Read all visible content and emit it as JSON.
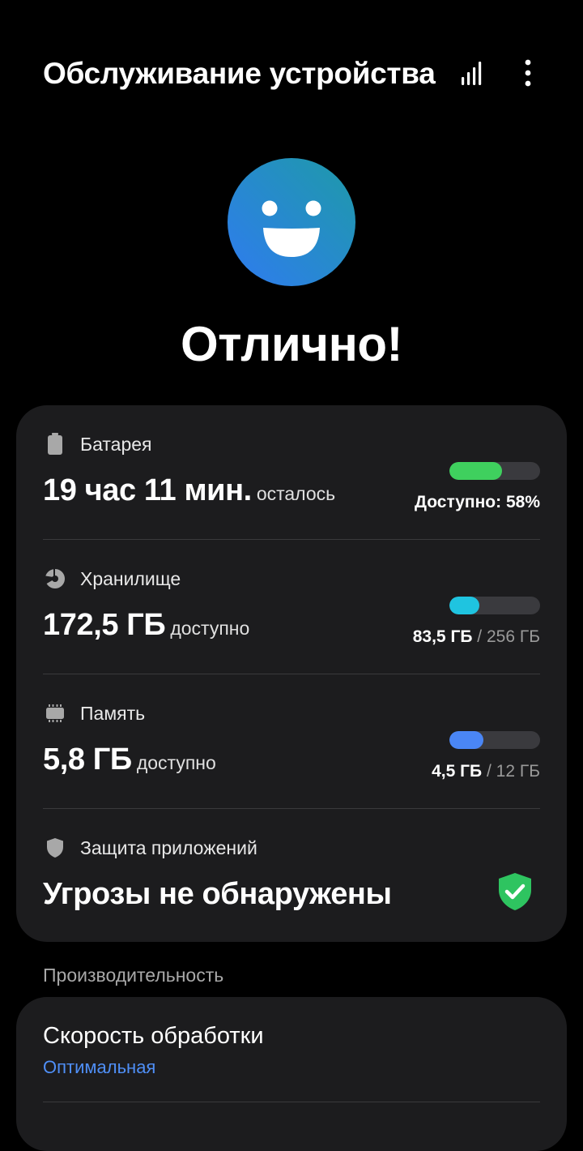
{
  "header": {
    "title": "Обслуживание устройства",
    "signal_icon": "signal-bars-icon",
    "more_icon": "more-vertical-icon"
  },
  "status": {
    "icon": "smiley-face-icon",
    "title": "Отлично!",
    "face_gradient": [
      "#2f7bf0",
      "#1e9aa8"
    ]
  },
  "battery": {
    "icon": "battery-icon",
    "label": "Батарея",
    "value": "19 час 11 мин.",
    "suffix": "осталось",
    "right_text": "Доступно: 58%",
    "fill_fraction": 0.58,
    "color": "#3fd05e"
  },
  "storage": {
    "icon": "pie-chart-icon",
    "label": "Хранилище",
    "value": "172,5 ГБ",
    "suffix": "доступно",
    "used": "83,5 ГБ",
    "separator": " / ",
    "total": "256 ГБ",
    "fill_fraction": 0.326,
    "color": "#1fc4e0"
  },
  "memory": {
    "icon": "memory-chip-icon",
    "label": "Память",
    "value": "5,8 ГБ",
    "suffix": "доступно",
    "used": "4,5 ГБ",
    "separator": " / ",
    "total": "12 ГБ",
    "fill_fraction": 0.375,
    "color": "#4a86f5"
  },
  "app_protection": {
    "icon": "shield-icon",
    "label": "Защита приложений",
    "value": "Угрозы не обнаружены",
    "status_icon": "shield-check-icon",
    "color": "#2ec460"
  },
  "performance": {
    "section_label": "Производительность",
    "title": "Скорость обработки",
    "subtitle": "Оптимальная",
    "accent": "#4f8ff7"
  }
}
